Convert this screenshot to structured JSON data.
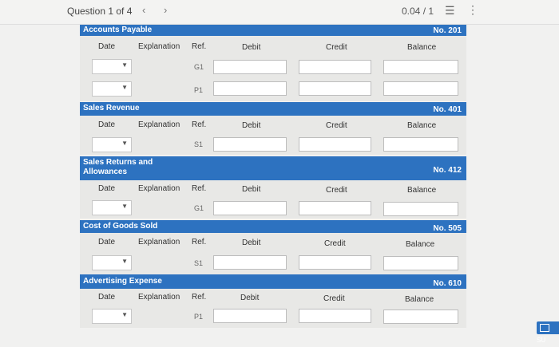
{
  "topbar": {
    "question_label": "Question 1 of 4",
    "prev_icon": "chevron-left",
    "next_icon": "chevron-right",
    "points": "0.04 / 1",
    "list_icon": "list-icon",
    "more_icon": "more-vertical-icon"
  },
  "columns": {
    "date": "Date",
    "explanation": "Explanation",
    "ref": "Ref.",
    "debit": "Debit",
    "credit": "Credit",
    "balance": "Balance"
  },
  "accounts": [
    {
      "name": "Accounts Payable",
      "number": "No. 201",
      "refs": [
        "G1",
        "P1"
      ]
    },
    {
      "name": "Sales Revenue",
      "number": "No. 401",
      "refs": [
        "S1"
      ]
    },
    {
      "name_line1": "Sales Returns and",
      "name_line2": "Allowances",
      "number": "No. 412",
      "refs": [
        "G1"
      ]
    },
    {
      "name": "Cost of Goods Sold",
      "number": "No. 505",
      "refs": [
        "S1"
      ]
    },
    {
      "name": "Advertising Expense",
      "number": "No. 610",
      "refs": [
        "P1"
      ]
    }
  ],
  "submit": {
    "label": "SU"
  }
}
